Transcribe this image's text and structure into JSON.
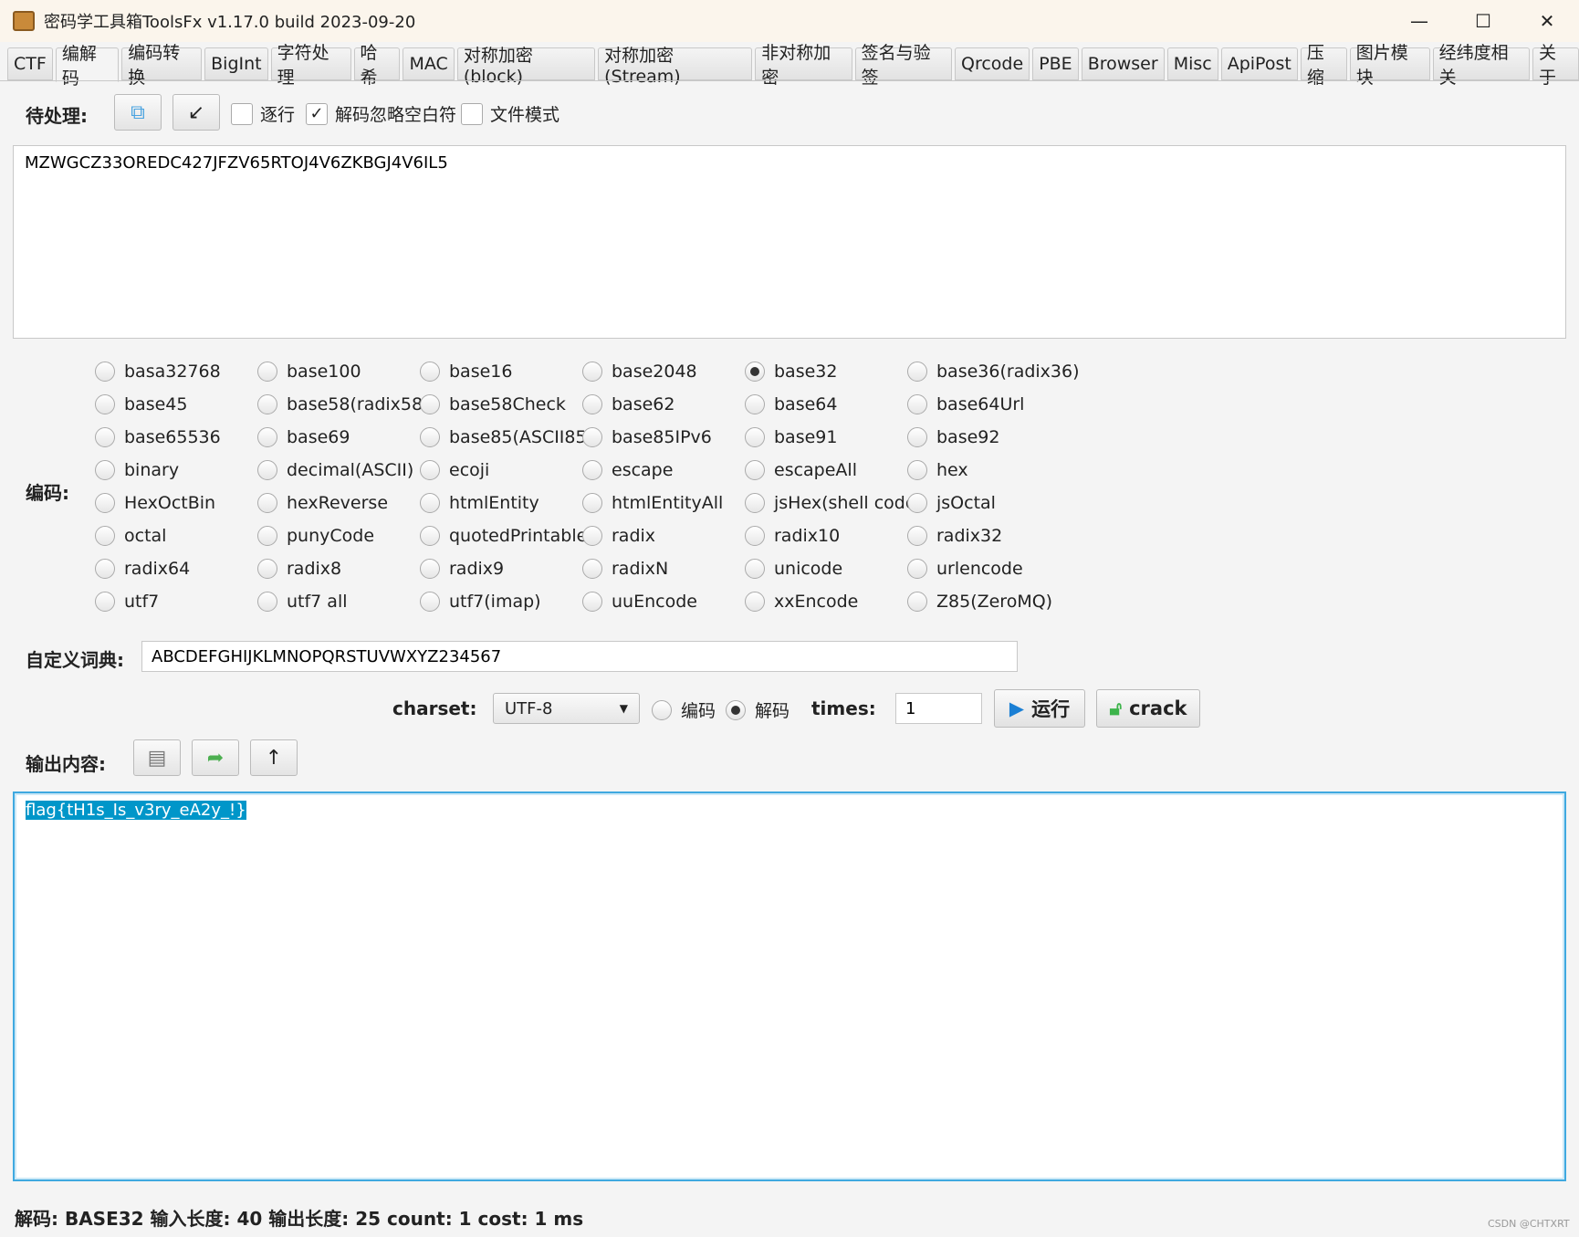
{
  "window": {
    "title": "密码学工具箱ToolsFx v1.17.0 build 2023-09-20",
    "minimize": "—",
    "maximize": "☐",
    "close": "✕"
  },
  "tabs": [
    "CTF",
    "编解码",
    "编码转换",
    "BigInt",
    "字符处理",
    "哈希",
    "MAC",
    "对称加密(block)",
    "对称加密(Stream)",
    "非对称加密",
    "签名与验签",
    "Qrcode",
    "PBE",
    "Browser",
    "Misc",
    "ApiPost",
    "压缩",
    "图片模块",
    "经纬度相关",
    "关于"
  ],
  "active_tab": "编解码",
  "input": {
    "label": "待处理:",
    "line_mode": "逐行",
    "ignore_whitespace": "解码忽略空白符",
    "file_mode": "文件模式",
    "line_mode_checked": false,
    "ignore_whitespace_checked": true,
    "file_mode_checked": false,
    "value": "MZWGCZ33OREDC427JFZV65RTOJ4V6ZKBGJ4V6IL5"
  },
  "encoding": {
    "label": "编码:",
    "selected": "base32",
    "options": [
      "basa32768",
      "base100",
      "base16",
      "base2048",
      "base32",
      "base36(radix36)",
      "base45",
      "base58(radix58)",
      "base58Check",
      "base62",
      "base64",
      "base64Url",
      "base65536",
      "base69",
      "base85(ASCII85)",
      "base85IPv6",
      "base91",
      "base92",
      "binary",
      "decimal(ASCII)",
      "ecoji",
      "escape",
      "escapeAll",
      "hex",
      "HexOctBin",
      "hexReverse",
      "htmlEntity",
      "htmlEntityAll",
      "jsHex(shell code)",
      "jsOctal",
      "octal",
      "punyCode",
      "quotedPrintable",
      "radix",
      "radix10",
      "radix32",
      "radix64",
      "radix8",
      "radix9",
      "radixN",
      "unicode",
      "urlencode",
      "utf7",
      "utf7 all",
      "utf7(imap)",
      "uuEncode",
      "xxEncode",
      "Z85(ZeroMQ)"
    ]
  },
  "dict": {
    "label": "自定义词典:",
    "value": "ABCDEFGHIJKLMNOPQRSTUVWXYZ234567"
  },
  "controls": {
    "charset_label": "charset:",
    "charset": "UTF-8",
    "encode": "编码",
    "decode": "解码",
    "mode": "解码",
    "times_label": "times:",
    "times": "1",
    "run": "运行",
    "crack": "crack"
  },
  "output": {
    "label": "输出内容:",
    "value": "flag{tH1s_Is_v3ry_eA2y_!}"
  },
  "status": "解码: BASE32  输入长度: 40  输出长度: 25 count: 1 cost: 1 ms",
  "watermark": "CSDN @CHTXRT"
}
